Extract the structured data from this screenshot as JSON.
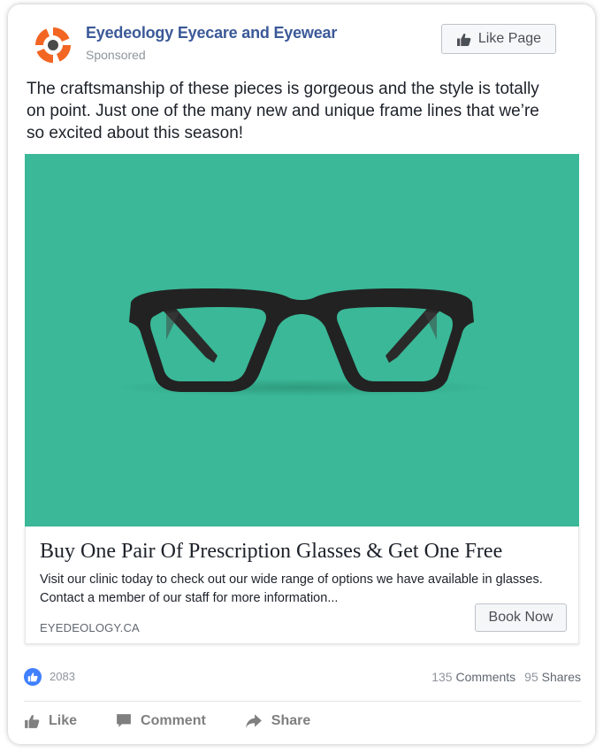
{
  "header": {
    "page_name": "Eyedeology Eyecare and Eyewear",
    "sponsored": "Sponsored",
    "like_page_label": "Like Page",
    "logo_icon": "eyedeology-logo",
    "brand_color": "#f26522"
  },
  "post_text": "The craftsmanship of these pieces is gorgeous and the style is totally on point. Just one of the many new and unique frame lines that we’re so excited about this season!",
  "image": {
    "subject": "glasses",
    "background_color": "#3ab897"
  },
  "link": {
    "headline": "Buy One Pair Of Prescription Glasses & Get One Free",
    "description": "Visit our clinic today to check out our wide range of options we have available in glasses. Contact a member of our staff for more information...",
    "domain": "EYEDEOLOGY.CA",
    "cta_label": "Book Now"
  },
  "stats": {
    "likes": "2083",
    "comments_count": "135",
    "comments_label": "Comments",
    "shares_count": "95",
    "shares_label": "Shares",
    "like_color": "#4080ff"
  },
  "actions": [
    {
      "label": "Like",
      "icon": "thumbs-up-icon"
    },
    {
      "label": "Comment",
      "icon": "comment-icon"
    },
    {
      "label": "Share",
      "icon": "share-arrow-icon"
    }
  ]
}
